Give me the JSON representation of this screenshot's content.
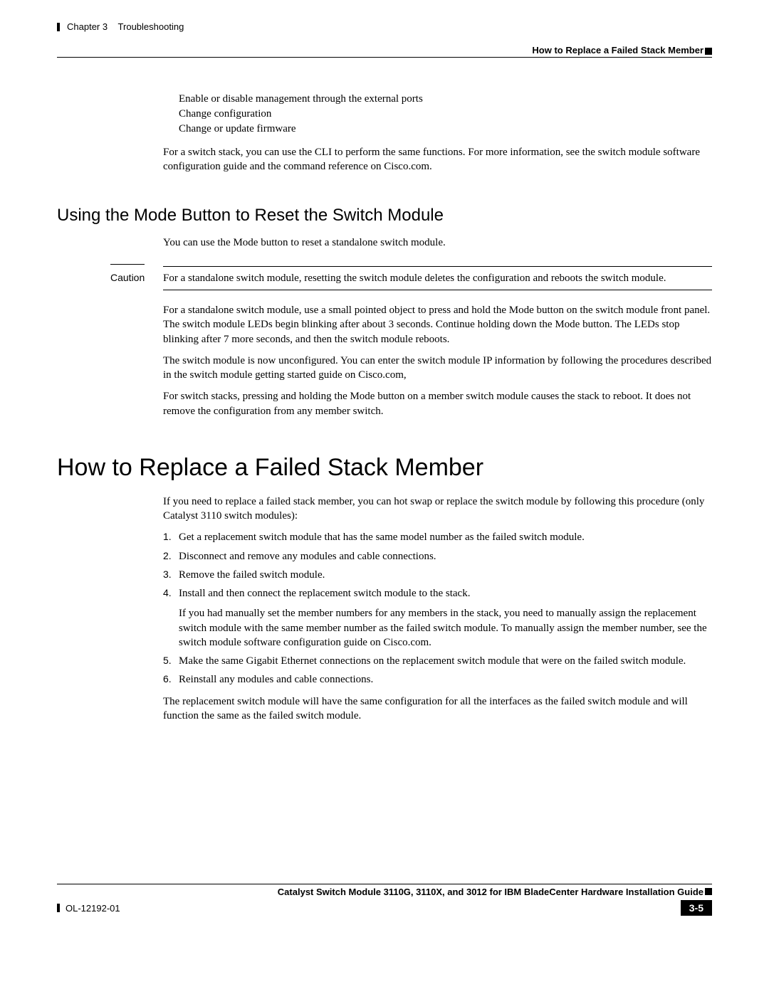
{
  "header": {
    "chapter": "Chapter 3",
    "chapterTitle": "Troubleshooting",
    "sectionRight": "How to Replace a Failed Stack Member"
  },
  "bullets": {
    "b1": "Enable or disable management through the external ports",
    "b2": "Change configuration",
    "b3": "Change or update firmware"
  },
  "paras": {
    "afterBullets": "For a switch stack, you can use the CLI to perform the same functions. For more information, see the switch module software configuration guide and the command reference on Cisco.com.",
    "modeButtonIntro": "You can use the Mode button to reset a standalone switch module.",
    "afterCaution1": "For a standalone switch module, use a small pointed object to press and hold the Mode button on the switch module front panel. The switch module LEDs begin blinking after about 3 seconds. Continue holding down the Mode button. The LEDs stop blinking after 7 more seconds, and then the switch module reboots.",
    "afterCaution2": "The switch module is now unconfigured. You can enter the switch module IP information by following the procedures described in the switch module getting started guide on Cisco.com,",
    "afterCaution3": "For switch stacks, pressing and holding the Mode button on a member switch module causes the stack to reboot. It does not remove the configuration from any member switch.",
    "replaceIntro": "If you need to replace a failed stack member, you can hot swap or replace the switch module by following this procedure (only Catalyst 3110 switch modules):",
    "replaceOutro": "The replacement switch module will have the same configuration for all the interfaces as the failed switch module and will function the same as the failed switch module."
  },
  "headings": {
    "modeButton": "Using the Mode Button to Reset the Switch Module",
    "replace": "How to Replace a Failed Stack Member"
  },
  "caution": {
    "label": "Caution",
    "text": "For a standalone switch module, resetting the switch module deletes the configuration and reboots the switch module."
  },
  "steps": {
    "s1": "Get a replacement switch module that has the same model number as the failed switch module.",
    "s2": "Disconnect and remove any modules and cable connections.",
    "s3": "Remove the failed switch module.",
    "s4": "Install and then connect the replacement switch module to the stack.",
    "s4b": "If you had manually set the member numbers for any members in the stack, you need to manually assign the replacement switch module with the same member number as the failed switch module. To manually assign the member number, see the switch module software configuration guide on Cisco.com.",
    "s5": "Make the same Gigabit Ethernet connections on the replacement switch module that were on the failed switch module.",
    "s6": "Reinstall any modules and cable connections."
  },
  "stepNums": {
    "n1": "1.",
    "n2": "2.",
    "n3": "3.",
    "n4": "4.",
    "n5": "5.",
    "n6": "6."
  },
  "footer": {
    "guideTitle": "Catalyst Switch Module 3110G, 3110X, and 3012 for IBM BladeCenter Hardware Installation Guide",
    "docId": "OL-12192-01",
    "pageNum": "3-5"
  }
}
